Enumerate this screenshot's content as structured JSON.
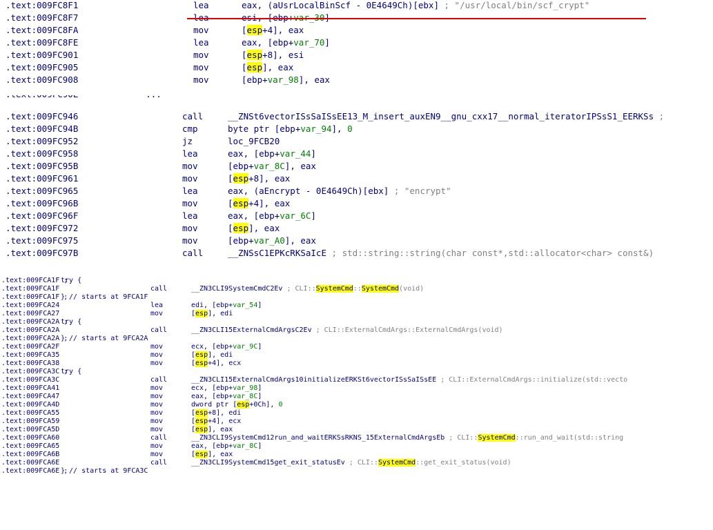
{
  "section1": [
    {
      "addr": ".text:009FC8F1",
      "mn": "lea",
      "op": "eax, (aUsrLocalBinScf - 0E4649Ch)[ebx]",
      "cmt": "; \"/usr/local/bin/scf_crypt\""
    },
    {
      "addr": ".text:009FC8F7",
      "mn": "lea",
      "op": "esi, [ebp+var_30]",
      "cmt": ""
    },
    {
      "addr": ".text:009FC8FA",
      "mn": "mov",
      "op": "[esp+4], eax",
      "cmt": ""
    },
    {
      "addr": ".text:009FC8FE",
      "mn": "lea",
      "op": "eax, [ebp+var_70]",
      "cmt": ""
    },
    {
      "addr": ".text:009FC901",
      "mn": "mov",
      "op": "[esp+8], esi",
      "cmt": ""
    },
    {
      "addr": ".text:009FC905",
      "mn": "mov",
      "op": "[esp], eax",
      "cmt": ""
    },
    {
      "addr": ".text:009FC908",
      "mn": "mov",
      "op": "[ebp+var_98], eax",
      "cmt": ""
    }
  ],
  "section2": [
    {
      "addr": ".text:009FC946",
      "mn": "call",
      "op": "__ZNSt6vectorISsSaISsEE13_M_insert_auxEN9__gnu_cxx17__normal_iteratorIPSsS1_EERKSs",
      "cmt": ";"
    },
    {
      "addr": ".text:009FC94B",
      "mn": "cmp",
      "op": "byte ptr [ebp+var_94], 0",
      "cmt": ""
    },
    {
      "addr": ".text:009FC952",
      "mn": "jz",
      "op": "loc_9FCB20",
      "cmt": ""
    },
    {
      "addr": ".text:009FC958",
      "mn": "lea",
      "op": "eax, [ebp+var_44]",
      "cmt": ""
    },
    {
      "addr": ".text:009FC95B",
      "mn": "mov",
      "op": "[ebp+var_8C], eax",
      "cmt": ""
    },
    {
      "addr": ".text:009FC961",
      "mn": "mov",
      "op": "[esp+8], eax",
      "cmt": ""
    },
    {
      "addr": ".text:009FC965",
      "mn": "lea",
      "op": "eax, (aEncrypt - 0E4649Ch)[ebx]",
      "cmt": "; \"encrypt\""
    },
    {
      "addr": ".text:009FC96B",
      "mn": "mov",
      "op": "[esp+4], eax",
      "cmt": ""
    },
    {
      "addr": ".text:009FC96F",
      "mn": "lea",
      "op": "eax, [ebp+var_6C]",
      "cmt": ""
    },
    {
      "addr": ".text:009FC972",
      "mn": "mov",
      "op": "[esp], eax",
      "cmt": ""
    },
    {
      "addr": ".text:009FC975",
      "mn": "mov",
      "op": "[ebp+var_A0], eax",
      "cmt": ""
    },
    {
      "addr": ".text:009FC97B",
      "mn": "call",
      "op": "__ZNSsC1EPKcRKSaIcE",
      "cmt": "; std::string::string(char const*,std::allocator<char> const&)"
    }
  ],
  "section3": [
    {
      "addr": ".text:009FCA1F ;",
      "mn": "try {",
      "op": "",
      "cmt": "",
      "kind": "try"
    },
    {
      "addr": ".text:009FCA1F",
      "mn": "call",
      "op": "__ZN3CLI9SystemCmdC2Ev",
      "cmt": "; CLI::SystemCmd::SystemCmd(void)"
    },
    {
      "addr": ".text:009FCA1F ;",
      "mn": "} // starts at 9FCA1F",
      "op": "",
      "cmt": "",
      "kind": "try"
    },
    {
      "addr": ".text:009FCA24",
      "mn": "lea",
      "op": "edi, [ebp+var_54]",
      "cmt": ""
    },
    {
      "addr": ".text:009FCA27",
      "mn": "mov",
      "op": "[esp], edi",
      "cmt": ""
    },
    {
      "addr": ".text:009FCA2A ;",
      "mn": "try {",
      "op": "",
      "cmt": "",
      "kind": "try"
    },
    {
      "addr": ".text:009FCA2A",
      "mn": "call",
      "op": "__ZN3CLI15ExternalCmdArgsC2Ev",
      "cmt": "; CLI::ExternalCmdArgs::ExternalCmdArgs(void)"
    },
    {
      "addr": ".text:009FCA2A ;",
      "mn": "} // starts at 9FCA2A",
      "op": "",
      "cmt": "",
      "kind": "try"
    },
    {
      "addr": ".text:009FCA2F",
      "mn": "mov",
      "op": "ecx, [ebp+var_9C]",
      "cmt": ""
    },
    {
      "addr": ".text:009FCA35",
      "mn": "mov",
      "op": "[esp], edi",
      "cmt": ""
    },
    {
      "addr": ".text:009FCA38",
      "mn": "mov",
      "op": "[esp+4], ecx",
      "cmt": ""
    },
    {
      "addr": ".text:009FCA3C ;",
      "mn": "try {",
      "op": "",
      "cmt": "",
      "kind": "try"
    },
    {
      "addr": ".text:009FCA3C",
      "mn": "call",
      "op": "__ZN3CLI15ExternalCmdArgs10initializeERKSt6vectorISsSaISsEE",
      "cmt": "; CLI::ExternalCmdArgs::initialize(std::vecto"
    },
    {
      "addr": ".text:009FCA41",
      "mn": "mov",
      "op": "ecx, [ebp+var_98]",
      "cmt": ""
    },
    {
      "addr": ".text:009FCA47",
      "mn": "mov",
      "op": "eax, [ebp+var_8C]",
      "cmt": ""
    },
    {
      "addr": ".text:009FCA4D",
      "mn": "mov",
      "op": "dword ptr [esp+0Ch], 0",
      "cmt": ""
    },
    {
      "addr": ".text:009FCA55",
      "mn": "mov",
      "op": "[esp+8], edi",
      "cmt": ""
    },
    {
      "addr": ".text:009FCA59",
      "mn": "mov",
      "op": "[esp+4], ecx",
      "cmt": ""
    },
    {
      "addr": ".text:009FCA5D",
      "mn": "mov",
      "op": "[esp], eax",
      "cmt": ""
    },
    {
      "addr": ".text:009FCA60",
      "mn": "call",
      "op": "__ZN3CLI9SystemCmd12run_and_waitERKSsRKNS_15ExternalCmdArgsEb",
      "cmt": "; CLI::SystemCmd::run_and_wait(std::string"
    },
    {
      "addr": ".text:009FCA65",
      "mn": "mov",
      "op": "eax, [ebp+var_8C]",
      "cmt": ""
    },
    {
      "addr": ".text:009FCA6B",
      "mn": "mov",
      "op": "[esp], eax",
      "cmt": ""
    },
    {
      "addr": ".text:009FCA6E",
      "mn": "call",
      "op": "__ZN3CLI9SystemCmd15get_exit_statusEv",
      "cmt": "; CLI::SystemCmd::get_exit_status(void)"
    },
    {
      "addr": ".text:009FCA6E ;",
      "mn": "} // starts at 9FCA3C",
      "op": "",
      "cmt": "",
      "kind": "try"
    }
  ],
  "highlight_word_esp": "esp",
  "highlight_word_systemcmd": "SystemCmd",
  "colors": {
    "address": "#000080",
    "comment": "#808080",
    "variable": "#008000",
    "highlight": "#ffff00",
    "underline": "#e00000"
  }
}
